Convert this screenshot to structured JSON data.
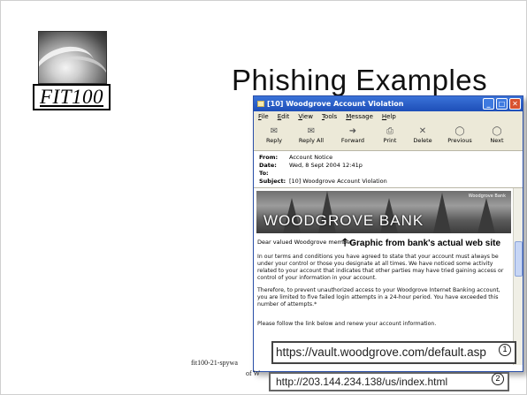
{
  "logo": {
    "text": "FIT100"
  },
  "slide": {
    "title": "Phishing Examples"
  },
  "window": {
    "title": "[10] Woodgrove Account Violation",
    "controls": [
      "_",
      "□",
      "✕"
    ],
    "menu": [
      "File",
      "Edit",
      "View",
      "Tools",
      "Message",
      "Help"
    ],
    "toolbar": [
      {
        "label": "Reply",
        "icon": "reply-icon",
        "glyph": "✉"
      },
      {
        "label": "Reply All",
        "icon": "reply-all-icon",
        "glyph": "✉"
      },
      {
        "label": "Forward",
        "icon": "forward-icon",
        "glyph": "➜"
      },
      {
        "label": "Print",
        "icon": "print-icon",
        "glyph": "⎙"
      },
      {
        "label": "Delete",
        "icon": "delete-icon",
        "glyph": "✕"
      },
      {
        "label": "Previous",
        "icon": "previous-icon",
        "glyph": "◯"
      },
      {
        "label": "Next",
        "icon": "next-icon",
        "glyph": "◯"
      }
    ],
    "headers": {
      "from_label": "From:",
      "from": "Account Notice",
      "date_label": "Date:",
      "date": "Wed, 8 Sept 2004 12:41p",
      "to_label": "To:",
      "to": "",
      "subject_label": "Subject:",
      "subject": "[10] Woodgrove Account Violation"
    },
    "body": {
      "banner": "WOODGROVE BANK",
      "banner_small": "Woodgrove Bank",
      "greeting": "Dear valued Woodgrove member,",
      "callout": "Graphic from bank's actual web site",
      "p1": "In our terms and conditions you have agreed to state that your account must always be under your control or those you designate at all times. We have noticed some activity related to your account that indicates that other parties may have tried gaining access or control of your information in your account.",
      "p2": "Therefore, to prevent unauthorized access to your Woodgrove Internet Banking account, you are limited to five failed login attempts in a 24-hour period.  You have exceeded this number of attempts.*",
      "p3": "Please follow the link below and renew your account information."
    }
  },
  "links": {
    "shown": "https://vault.woodgrove.com/default.asp",
    "actual": "http://203.144.234.138/us/index.html",
    "badge1": "1",
    "badge2": "2"
  },
  "footer": {
    "line1": "fit100-21-spywa",
    "line2": "of W"
  }
}
